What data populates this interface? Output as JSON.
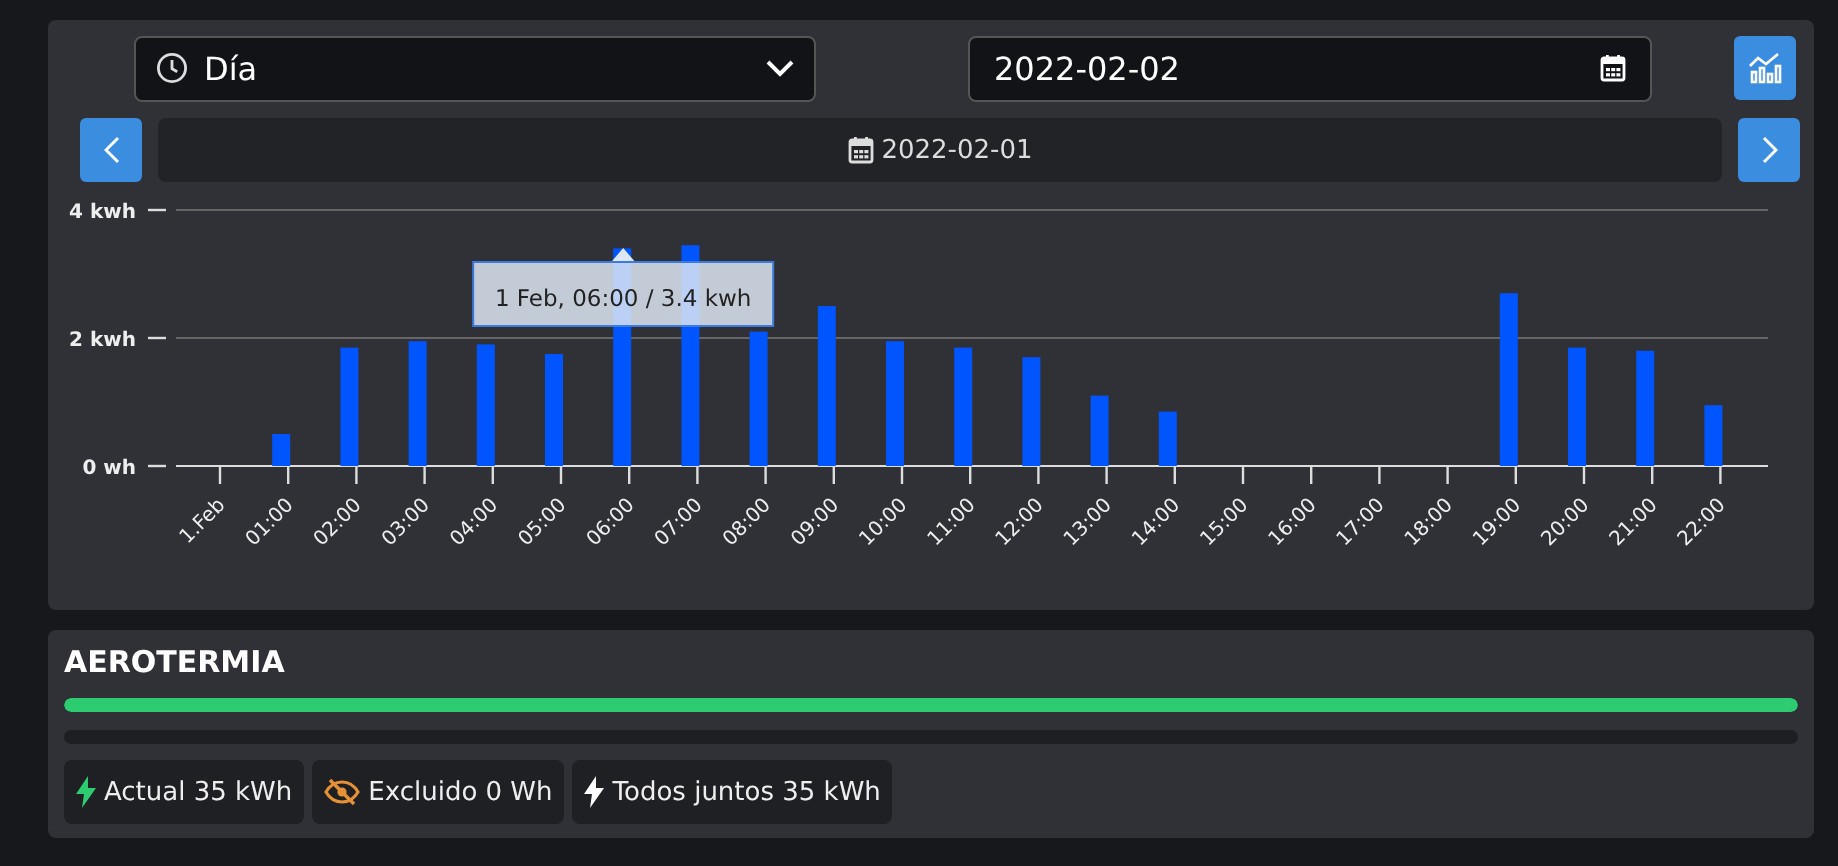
{
  "controls": {
    "period": {
      "value": "Día"
    },
    "date": {
      "value": "2022-02-02"
    },
    "current_date": "2022-02-01"
  },
  "chart": {
    "chart_data": {
      "type": "bar",
      "categories": [
        "1.Feb",
        "01:00",
        "02:00",
        "03:00",
        "04:00",
        "05:00",
        "06:00",
        "07:00",
        "08:00",
        "09:00",
        "10:00",
        "11:00",
        "12:00",
        "13:00",
        "14:00",
        "15:00",
        "16:00",
        "17:00",
        "18:00",
        "19:00",
        "20:00",
        "21:00",
        "22:00"
      ],
      "series": [
        {
          "color": "#0055ff",
          "values": [
            0,
            0.5,
            1.85,
            1.95,
            1.9,
            1.75,
            3.4,
            3.45,
            2.1,
            2.5,
            1.95,
            1.85,
            1.7,
            1.1,
            0.85,
            0,
            0,
            0,
            0,
            2.7,
            1.85,
            1.8,
            0.95
          ]
        }
      ],
      "ylim": [
        0,
        4
      ],
      "yticks": [
        {
          "value": 0,
          "label": "0 wh"
        },
        {
          "value": 2,
          "label": "2 kwh"
        },
        {
          "value": 4,
          "label": "4 kwh"
        }
      ]
    },
    "tooltip": {
      "text": "1 Feb, 06:00 / 3.4 kwh"
    }
  },
  "summary": {
    "title": "AEROTERMIA",
    "bars": [
      {
        "level": 1
      },
      {
        "level": 0
      }
    ],
    "badges": [
      {
        "kind": "bolt",
        "color": "#2ecc71",
        "text": "Actual 35 kWh"
      },
      {
        "kind": "hidden",
        "color": "#e69138",
        "text": "Excluido 0 Wh"
      },
      {
        "kind": "bolt",
        "color": "#ffffff",
        "text": "Todos juntos 35 kWh"
      }
    ]
  }
}
